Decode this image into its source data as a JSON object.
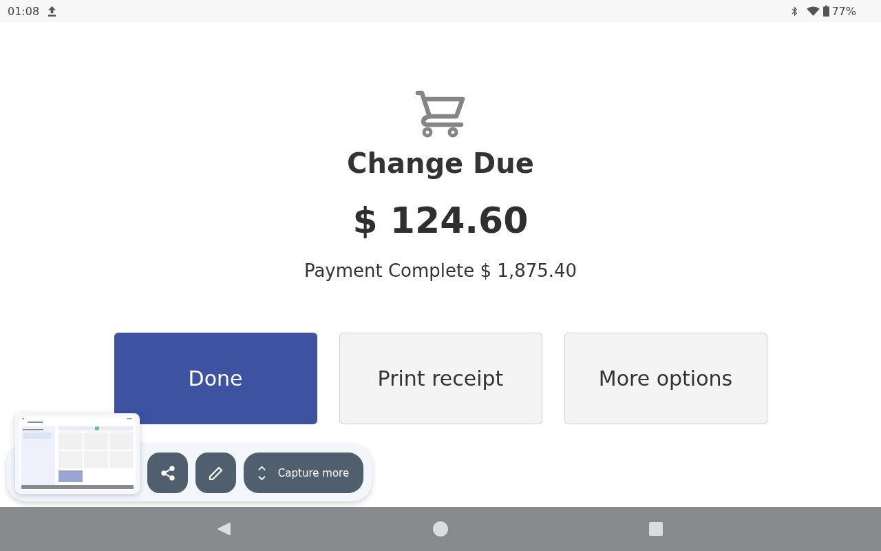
{
  "status_bar": {
    "time": "01:08",
    "battery": "77%"
  },
  "payment": {
    "title": "Change Due",
    "amount": "$ 124.60",
    "summary": "Payment Complete $ 1,875.40"
  },
  "actions": [
    {
      "label": "Done",
      "kind": "primary"
    },
    {
      "label": "Print receipt",
      "kind": "secondary"
    },
    {
      "label": "More options",
      "kind": "secondary"
    }
  ],
  "screenshot_toolbar": {
    "capture_label": "Capture more"
  }
}
